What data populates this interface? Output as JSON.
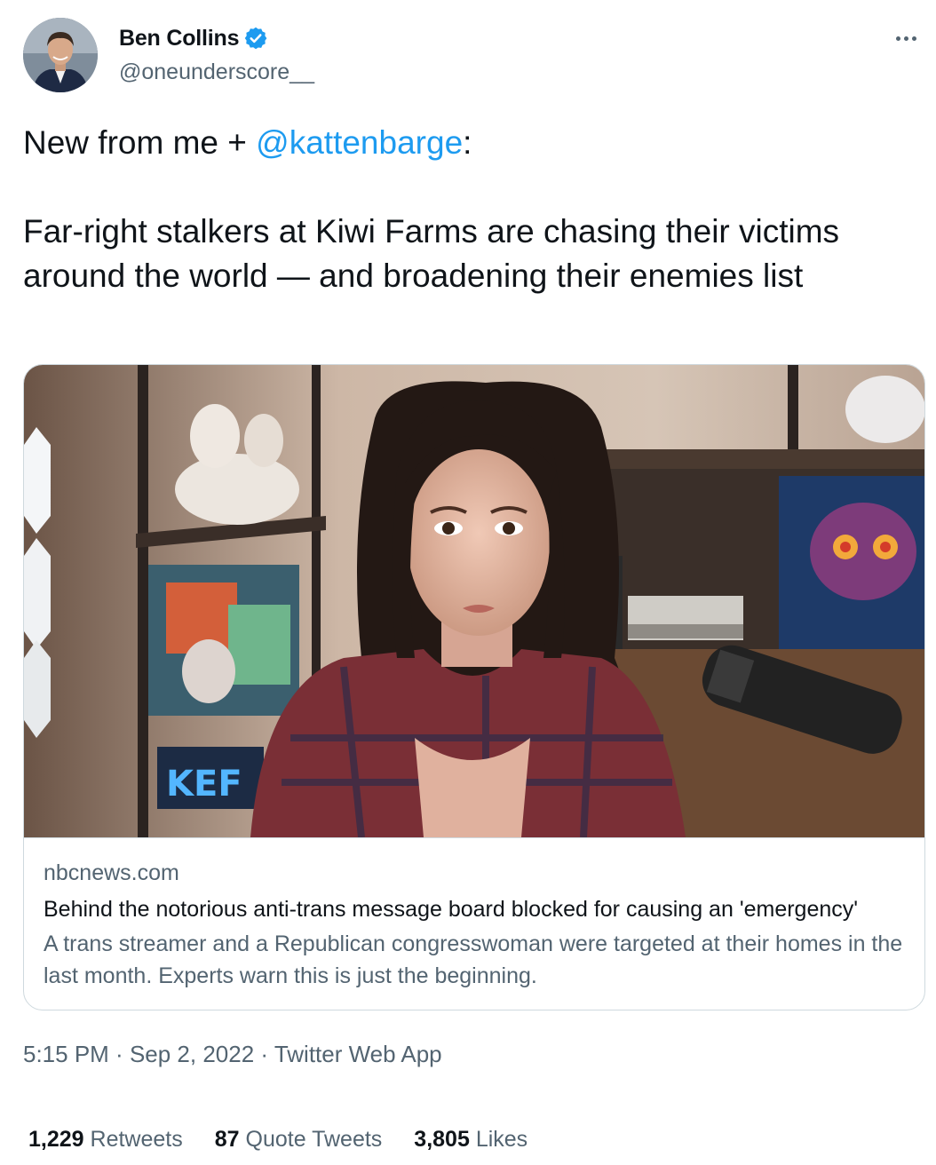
{
  "author": {
    "display_name": "Ben Collins",
    "handle": "@oneunderscore__",
    "verified_icon": "verified-badge-icon",
    "avatar_icon": "avatar-photo"
  },
  "more_icon": "more-dots-icon",
  "tweet": {
    "line1_prefix": "New from me + ",
    "mention": "@kattenbarge",
    "line1_suffix": ":",
    "paragraph2": "Far-right stalkers at Kiwi Farms are chasing their victims around the world — and broadening their enemies list"
  },
  "link_card": {
    "image": "article-thumbnail-photo",
    "domain": "nbcnews.com",
    "title": "Behind the notorious anti-trans message board blocked for causing an 'emergency'",
    "description": "A trans streamer and a Republican congresswoman were targeted at their homes in the last month. Experts warn this is just the beginning."
  },
  "meta": {
    "time": "5:15 PM",
    "separator": " · ",
    "date": "Sep 2, 2022",
    "source": "Twitter Web App"
  },
  "stats": {
    "retweets_count": "1,229",
    "retweets_label": "Retweets",
    "quotes_count": "87",
    "quotes_label": "Quote Tweets",
    "likes_count": "3,805",
    "likes_label": "Likes"
  },
  "colors": {
    "accent": "#1d9bf0",
    "text_primary": "#0f1419",
    "text_secondary": "#536471",
    "border": "#cfd9de"
  }
}
